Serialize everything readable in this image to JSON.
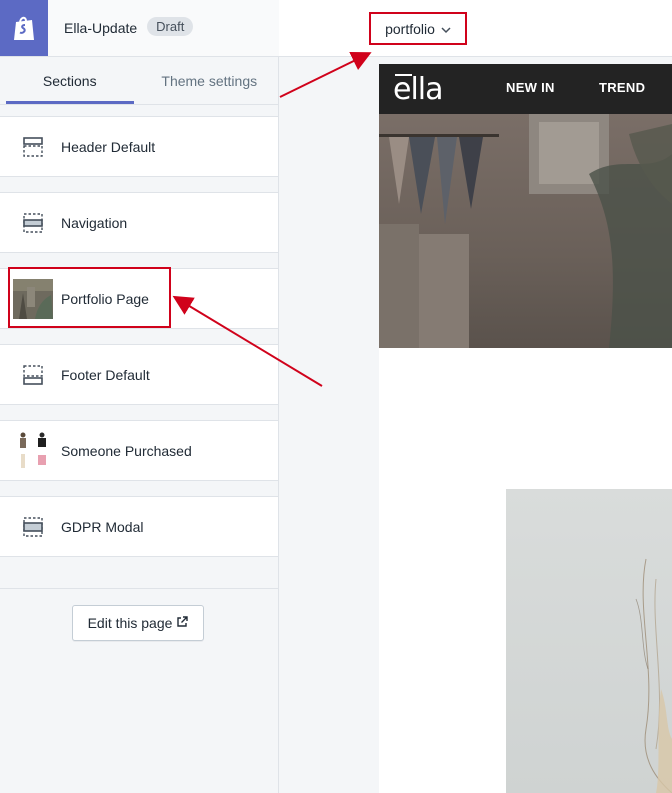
{
  "topbar": {
    "store_name": "Ella-Update",
    "badge": "Draft",
    "logo_icon": "shopify-bag-icon"
  },
  "tabs": [
    {
      "label": "Sections",
      "active": true
    },
    {
      "label": "Theme settings",
      "active": false
    }
  ],
  "sections": [
    {
      "label": "Header Default",
      "icon": "header-layout-icon"
    },
    {
      "label": "Navigation",
      "icon": "navigation-layout-icon"
    },
    {
      "label": "Portfolio Page",
      "icon": "portfolio-thumbnail"
    },
    {
      "label": "Footer Default",
      "icon": "footer-layout-icon"
    },
    {
      "label": "Someone Purchased",
      "icon": "products-thumbnail"
    },
    {
      "label": "GDPR Modal",
      "icon": "modal-layout-icon"
    }
  ],
  "edit_button": {
    "label": "Edit this page",
    "icon": "external-link-icon"
  },
  "page_selector": {
    "value": "portfolio",
    "icon": "chevron-down-icon"
  },
  "preview": {
    "logo": "ella",
    "nav": [
      "NEW IN",
      "TREND"
    ]
  },
  "colors": {
    "accent": "#5c6ac4",
    "annotation": "#d0021b",
    "store_header": "#232323"
  }
}
